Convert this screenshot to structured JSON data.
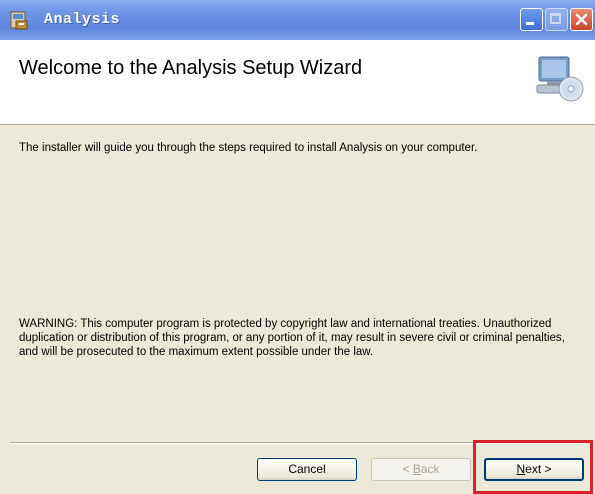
{
  "window": {
    "title": "Analysis"
  },
  "banner": {
    "title": "Welcome to the Analysis Setup Wizard"
  },
  "content": {
    "intro": "The installer will guide you through the steps required to install  Analysis on your computer.",
    "warning": "WARNING: This computer program is protected by copyright law and international treaties. Unauthorized duplication or distribution of this program, or any portion of it, may result in severe civil or criminal penalties, and will be prosecuted to the maximum extent possible under the law."
  },
  "buttons": {
    "cancel": "Cancel",
    "back_mnemonic": "B",
    "back_rest": "ack",
    "back_prefix": "< ",
    "next_mnemonic": "N",
    "next_rest": "ext >"
  },
  "colors": {
    "titlebar": "#6e95e6",
    "highlight": "#d9232b",
    "dialog_bg": "#ece9d8"
  },
  "icons": {
    "window": "installer-icon",
    "banner": "computer-cd-icon"
  }
}
